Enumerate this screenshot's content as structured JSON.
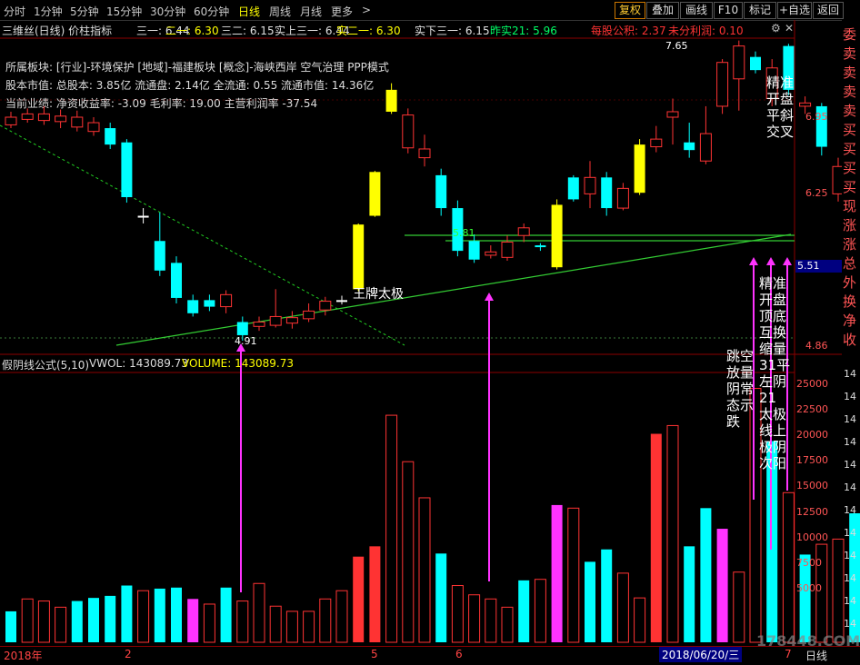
{
  "toolbar": {
    "timeframes": [
      "分时",
      "1分钟",
      "5分钟",
      "15分钟",
      "30分钟",
      "60分钟",
      "日线",
      "周线",
      "月线",
      "更多"
    ],
    "active_timeframe": "日线",
    "more_arrow": ">",
    "buttons": [
      "复权",
      "叠加",
      "画线",
      "F10",
      "标记",
      "+自选",
      "返回"
    ],
    "highlight_button": "复权"
  },
  "indicator_bar": {
    "name": "三维丝(日线) 价柱指标",
    "items": [
      {
        "label": "三一: 6.44",
        "color": "#e0e0e0"
      },
      {
        "label": "二一: 6.30",
        "color": "#ffff00"
      },
      {
        "label": "三二: 6.15",
        "color": "#e0e0e0"
      },
      {
        "label": "实上三一: 6.44",
        "color": "#e0e0e0"
      },
      {
        "label": "实二一: 6.30",
        "color": "#ffff00"
      },
      {
        "label": "实下三一: 6.15",
        "color": "#e0e0e0"
      },
      {
        "label": "昨实21: 5.96",
        "color": "#00ff66"
      },
      {
        "label": "每股公积: 2.37",
        "color": "#ff3333"
      },
      {
        "label": "未分利润: 0.10",
        "color": "#ff3333"
      }
    ]
  },
  "info": {
    "sector": "所属板块: [行业]-环境保护 [地域]-福建板块 [概念]-海峡西岸 空气治理 PPP模式",
    "shares": "股本市值: 总股本: 3.85亿 流通盘: 2.14亿 全流通: 0.55 流通市值: 14.36亿",
    "perf": "当前业绩: 净资收益率: -3.09 毛利率: 19.00 主营利润率 -37.54"
  },
  "price_axis": {
    "labels": [
      "6.95",
      "6.25",
      "5.51",
      "4.86"
    ],
    "current": "5.51"
  },
  "price_marks": {
    "high": "7.65",
    "low": "4.91",
    "mid": "5.81"
  },
  "annotations": {
    "trend": "王牌太极",
    "right_top": "精准\n开盘\n平斜\n交叉",
    "volume_left": "跳空\n放量\n阴常\n态示\n跌",
    "volume_right": "精准\n开盘\n顶底\n互换\n缩量\n31平\n左阴\n21\n太极\n线上\n极阴\n次阳"
  },
  "volume_header": {
    "name": "假阴线公式(5,10)",
    "vwol": "VWOL: 143089.73",
    "volume": "VOLUME: 143089.73"
  },
  "volume_axis": [
    "25000",
    "22500",
    "20000",
    "17500",
    "15000",
    "12500",
    "10000",
    "7500",
    "5000"
  ],
  "right_chars": [
    {
      "t": "委",
      "c": "#ff5555"
    },
    {
      "t": "卖",
      "c": "#ff5555"
    },
    {
      "t": "卖",
      "c": "#ff5555"
    },
    {
      "t": "卖",
      "c": "#ff5555"
    },
    {
      "t": "卖",
      "c": "#ff5555"
    },
    {
      "t": "买",
      "c": "#ff5555"
    },
    {
      "t": "买",
      "c": "#ff5555"
    },
    {
      "t": "买",
      "c": "#ff5555"
    },
    {
      "t": "买",
      "c": "#ff5555"
    },
    {
      "t": "现",
      "c": "#ff5555"
    },
    {
      "t": "涨",
      "c": "#ff5555"
    },
    {
      "t": "涨",
      "c": "#ff5555"
    },
    {
      "t": "总",
      "c": "#ff5555"
    },
    {
      "t": "外",
      "c": "#ff5555"
    },
    {
      "t": "换",
      "c": "#ff5555"
    },
    {
      "t": "净",
      "c": "#ff5555"
    },
    {
      "t": "收",
      "c": "#ff5555"
    }
  ],
  "right_vol_digits": "14",
  "bottom": {
    "dates": [
      "2018年",
      "2",
      "5",
      "6",
      "7"
    ],
    "cursor_date": "2018/06/20/三",
    "period": "日线",
    "watermark": "178448.COM"
  },
  "candles": [
    [
      6.88,
      6.95,
      7.0,
      6.85,
      1
    ],
    [
      6.93,
      6.98,
      7.03,
      6.9,
      1
    ],
    [
      6.98,
      6.92,
      7.05,
      6.88,
      1
    ],
    [
      6.96,
      6.91,
      7.02,
      6.85,
      1
    ],
    [
      6.95,
      6.86,
      7.01,
      6.82,
      1
    ],
    [
      6.9,
      6.82,
      6.95,
      6.78,
      1
    ],
    [
      6.85,
      6.7,
      6.9,
      6.66,
      0
    ],
    [
      6.72,
      6.22,
      6.75,
      6.17,
      0
    ],
    [
      6.05,
      6.05,
      6.12,
      5.98,
      2
    ],
    [
      5.82,
      5.55,
      6.08,
      5.5,
      0
    ],
    [
      5.62,
      5.3,
      5.68,
      5.25,
      0
    ],
    [
      5.28,
      5.16,
      5.33,
      5.13,
      0
    ],
    [
      5.28,
      5.22,
      5.33,
      5.18,
      0
    ],
    [
      5.22,
      5.33,
      5.37,
      5.16,
      1
    ],
    [
      5.08,
      4.96,
      5.13,
      4.91,
      0
    ],
    [
      5.04,
      5.08,
      5.13,
      5.0,
      1
    ],
    [
      5.05,
      5.13,
      5.38,
      5.03,
      1
    ],
    [
      5.07,
      5.12,
      5.18,
      5.02,
      1
    ],
    [
      5.11,
      5.18,
      5.25,
      5.08,
      1
    ],
    [
      5.19,
      5.27,
      5.31,
      5.14,
      1
    ],
    [
      5.28,
      5.28,
      5.32,
      5.24,
      2
    ],
    [
      5.38,
      5.97,
      5.98,
      5.36,
      3
    ],
    [
      6.05,
      6.45,
      6.46,
      6.04,
      3
    ],
    [
      7.2,
      7.0,
      7.26,
      6.98,
      3
    ],
    [
      6.97,
      6.67,
      7.03,
      6.62,
      1
    ],
    [
      6.66,
      6.58,
      6.79,
      6.5,
      1
    ],
    [
      6.42,
      6.12,
      6.48,
      6.05,
      0
    ],
    [
      6.12,
      5.73,
      6.19,
      5.68,
      0
    ],
    [
      5.82,
      5.65,
      5.88,
      5.62,
      0
    ],
    [
      5.72,
      5.69,
      5.78,
      5.66,
      1
    ],
    [
      5.67,
      5.81,
      5.87,
      5.64,
      1
    ],
    [
      5.87,
      5.94,
      5.98,
      5.81,
      1
    ],
    [
      5.78,
      5.78,
      5.8,
      5.73,
      0
    ],
    [
      5.58,
      6.15,
      6.2,
      5.56,
      3
    ],
    [
      6.4,
      6.2,
      6.42,
      6.18,
      0
    ],
    [
      6.25,
      6.4,
      6.55,
      6.12,
      1
    ],
    [
      6.4,
      6.12,
      6.45,
      6.05,
      0
    ],
    [
      6.12,
      6.3,
      6.35,
      6.1,
      1
    ],
    [
      6.26,
      6.7,
      6.75,
      6.24,
      3
    ],
    [
      6.68,
      6.75,
      6.87,
      6.63,
      1
    ],
    [
      6.95,
      7.0,
      7.12,
      6.7,
      1
    ],
    [
      6.72,
      6.65,
      6.9,
      6.58,
      0
    ],
    [
      6.55,
      6.8,
      7.05,
      6.52,
      1
    ],
    [
      7.05,
      7.45,
      7.48,
      6.98,
      1
    ],
    [
      7.6,
      7.3,
      7.65,
      7.01,
      1
    ],
    [
      7.5,
      7.38,
      7.55,
      7.35,
      0
    ],
    [
      7.4,
      7.12,
      7.48,
      7.05,
      1
    ],
    [
      7.6,
      7.2,
      7.62,
      7.15,
      0
    ],
    [
      7.05,
      7.08,
      7.14,
      6.98,
      1
    ],
    [
      7.05,
      6.68,
      7.08,
      6.6,
      0
    ],
    [
      6.5,
      6.25,
      6.58,
      6.18,
      1
    ],
    [
      6.48,
      6.05,
      6.53,
      6.0,
      0
    ],
    [
      6.06,
      6.06,
      6.13,
      5.98,
      1
    ],
    [
      6.56,
      6.59,
      6.6,
      6.05,
      3
    ]
  ],
  "volumes": [
    [
      3000,
      0
    ],
    [
      4200,
      1
    ],
    [
      4000,
      1
    ],
    [
      3400,
      1
    ],
    [
      4000,
      0
    ],
    [
      4300,
      0
    ],
    [
      4500,
      0
    ],
    [
      5500,
      0
    ],
    [
      5000,
      1
    ],
    [
      5200,
      0
    ],
    [
      5300,
      0
    ],
    [
      4200,
      2
    ],
    [
      3700,
      1
    ],
    [
      5300,
      0
    ],
    [
      4000,
      1
    ],
    [
      5700,
      1
    ],
    [
      3500,
      1
    ],
    [
      3000,
      1
    ],
    [
      3000,
      1
    ],
    [
      4200,
      1
    ],
    [
      5000,
      1
    ],
    [
      8300,
      3
    ],
    [
      9300,
      3
    ],
    [
      22000,
      1
    ],
    [
      17500,
      1
    ],
    [
      14000,
      1
    ],
    [
      8600,
      0
    ],
    [
      5500,
      1
    ],
    [
      4600,
      1
    ],
    [
      4200,
      1
    ],
    [
      3400,
      1
    ],
    [
      6000,
      0
    ],
    [
      6100,
      1
    ],
    [
      13300,
      2
    ],
    [
      13000,
      1
    ],
    [
      7800,
      0
    ],
    [
      9000,
      0
    ],
    [
      6700,
      1
    ],
    [
      4300,
      1
    ],
    [
      20200,
      3
    ],
    [
      21000,
      1
    ],
    [
      9300,
      0
    ],
    [
      13000,
      0
    ],
    [
      11000,
      2
    ],
    [
      6800,
      1
    ],
    [
      24600,
      1
    ],
    [
      19500,
      0
    ],
    [
      14500,
      1
    ],
    [
      8500,
      0
    ],
    [
      9500,
      1
    ],
    [
      10000,
      1
    ],
    [
      12500,
      0
    ],
    [
      6900,
      1
    ],
    [
      14500,
      3
    ]
  ]
}
